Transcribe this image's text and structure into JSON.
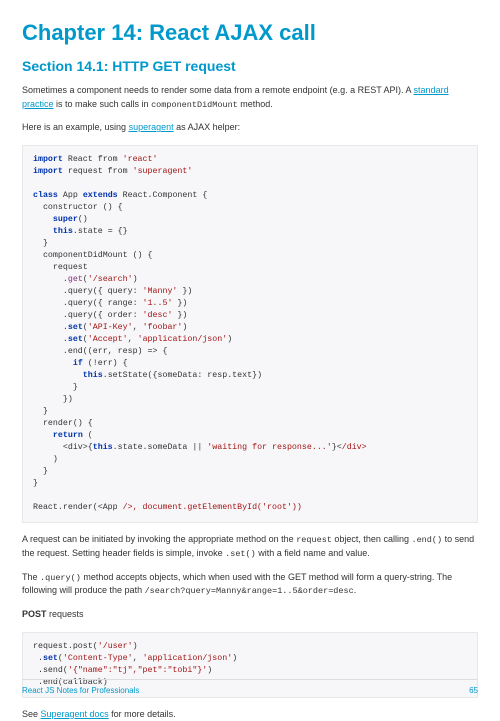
{
  "chapter_title": "Chapter 14: React AJAX call",
  "section_title": "Section 14.1: HTTP GET request",
  "para1_a": "Sometimes a component needs to render some data from a remote endpoint (e.g. a REST API). A ",
  "para1_link": "standard practice",
  "para1_b": " is to make such calls in ",
  "para1_c": "componentDidMount",
  "para1_d": " method.",
  "para2_a": "Here is an example, using ",
  "para2_link": "superagent",
  "para2_b": " as AJAX helper:",
  "para3_a": "A request can be initiated by invoking the appropriate method on the ",
  "para3_b": "request",
  "para3_c": " object, then calling ",
  "para3_d": ".end()",
  "para3_e": " to send the request. Setting header fields is simple, invoke ",
  "para3_f": ".set()",
  "para3_g": " with a field name and value.",
  "para4_a": "The ",
  "para4_b": ".query()",
  "para4_c": " method accepts objects, which when used with the GET method will form a query-string. The following will produce the path ",
  "para4_d": "/search?query=Manny&range=1..5&order=desc",
  "para4_e": ".",
  "para5_a": "POST",
  "para5_b": " requests",
  "para6_a": "See ",
  "para6_link": "Superagent docs",
  "para6_b": " for more details.",
  "footer_left": "React JS Notes for Professionals",
  "footer_right": "65"
}
